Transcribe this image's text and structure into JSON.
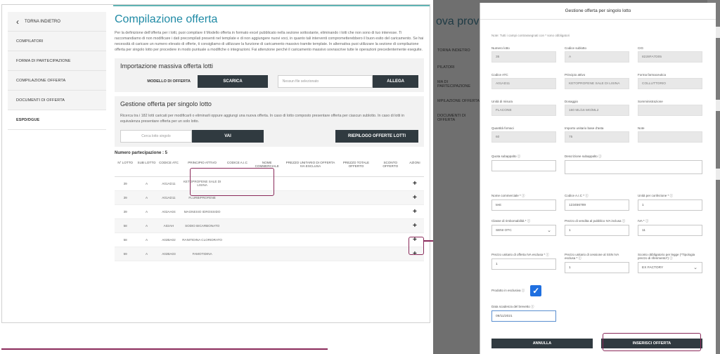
{
  "sidebar": {
    "back_label": "TORNA INDIETRO",
    "items": [
      {
        "label": "COMPILATORI"
      },
      {
        "label": "FORMA DI PARTECIPAZIONE"
      },
      {
        "label": "COMPILAZIONE OFFERTA"
      },
      {
        "label": "DOCUMENTI DI OFFERTA"
      },
      {
        "label": "ESPD/DGUE"
      }
    ]
  },
  "main": {
    "title": "Compilazione offerta",
    "intro": "Per la definizione dell'offerta per i lotti, puoi compilare il Modello offerta in formato excel pubblicato nella sezione sottostante, eliminando i lotti che non sono di tuo interesse. Ti raccomandiamo di non modificare i dati precompilati presenti nel template e di non aggiungere nuovi voci, in quanto tali interventi comprometterebbero il buon esito del caricamento. Se hai necessità di caricare un numero elevato di offerte, ti consigliamo di utilizzare la funzione di caricamento massivo tramite template. In alternativa puoi utilizzare la sezione di compilazione offerta per singolo lotto per procedere in modo puntuale a modifiche o integrazioni. Fai attenzione perché il caricamento massivo sovrascrive tutte le operazioni precedentemente eseguite.",
    "bulk": {
      "title": "Importazione massiva offerta lotti",
      "model_label": "MODELLO DI OFFERTA",
      "download_label": "SCARICA",
      "file_placeholder": "Nessun file selezionato",
      "attach_label": "ALLEGA"
    },
    "single": {
      "title": "Gestione offerta per singolo lotto",
      "description": "Ricerca tra i 182 lotti caricati per modificarli o eliminarli oppure aggiungi una nuova offerta. In caso di lotto composto presentare offerta per ciascun sublotto. In caso di lotti in equivalenza presentare offerta per un solo lotto.",
      "search_placeholder": "Cerca lotto singolo",
      "go_label": "VAI",
      "summary_label": "RIEPILOGO OFFERTE LOTTI"
    },
    "participations": "Numero partecipazione : 5",
    "table": {
      "headers": [
        "N° LOTTO",
        "SUB LOTTO",
        "CODICE ATC",
        "PRINCIPIO ATTIVO",
        "CODICE A.I.C",
        "NOME COMMERCIALE",
        "PREZZO UNITARIO DI OFFERTA IVA ESCLUSA",
        "PREZZO TOTALE OFFERTO",
        "SCONTO OFFERTO",
        "AZIONI"
      ],
      "rows": [
        {
          "lotto": "39",
          "sub": "A",
          "atc": "A01AD11",
          "principio": "KETOPROFENE SALE DI LISINA"
        },
        {
          "lotto": "39",
          "sub": "A",
          "atc": "A01AD11",
          "principio": "FLURBIPROFENE"
        },
        {
          "lotto": "39",
          "sub": "A",
          "atc": "A02AA04",
          "principio": "MAGNESIO IDROSSIDO"
        },
        {
          "lotto": "58",
          "sub": "A",
          "atc": "A02AH",
          "principio": "SODIO BICARBONATO"
        },
        {
          "lotto": "58",
          "sub": "A",
          "atc": "A02BA02",
          "principio": "RANITIDINA CLORIDRATO"
        },
        {
          "lotto": "59",
          "sub": "A",
          "atc": "A02BA03",
          "principio": "FAMOTIDINA"
        }
      ]
    }
  },
  "background": {
    "title": "ova prova",
    "side_items": [
      "TORNA INDIETRO",
      "PILATORI",
      "MA DI PARTECIPAZIONE",
      "MPILAZIONE OFFERTA",
      "DOCUMENTI DI OFFERTA"
    ]
  },
  "modal": {
    "title": "Gestione offerta per singolo lotto",
    "note": "Note: Tutti i campi contrassegnati con * sono obbligatori",
    "fields": {
      "numero_lotto": {
        "label": "Numero lotto",
        "value": "35"
      },
      "codice_sublotto": {
        "label": "Codice sublotto",
        "value": "A"
      },
      "cig": {
        "label": "CIG",
        "value": "8228FA7D05"
      },
      "codice_atc": {
        "label": "Codice ATC",
        "value": "A01AD11"
      },
      "principio_attivo": {
        "label": "Principio attivo",
        "value": "KETOPROFENE SALE DI LISINA"
      },
      "forma_farmaceutica": {
        "label": "Forma farmaceutica",
        "value": "COLLUTTORIO"
      },
      "unita_misura": {
        "label": "Unità di misura",
        "value": "FLACONE"
      },
      "dosaggio": {
        "label": "Dosaggio",
        "value": "160 ML/16 MG/ML2"
      },
      "somministrazione": {
        "label": "Somministrazione",
        "value": ""
      },
      "quantita": {
        "label": "Quantità fornaci",
        "value": "60"
      },
      "importo_base": {
        "label": "Importo unitario base d'asta",
        "value": "75"
      },
      "note": {
        "label": "Note",
        "value": ""
      },
      "quota_subappalto": {
        "label": "Quota subappalto ⓘ",
        "value": ""
      },
      "descrizione_subappalto": {
        "label": "Descrizione subappalto ⓘ",
        "value": ""
      },
      "nome_commerciale": {
        "label": "Nome commerciale * ⓘ",
        "value": "test"
      },
      "codice_aic": {
        "label": "Codice A.I.C * ⓘ",
        "value": "123456789"
      },
      "unita_confezione": {
        "label": "Unità per confezione * ⓘ",
        "value": "1"
      },
      "classe_rimborsabilita": {
        "label": "Classe di rimborsabilità * ⓘ",
        "value": "SENI OTC"
      },
      "prezzo_vendita": {
        "label": "Prezzo di vendita al pubblico IVA inclusa ⓘ",
        "value": "1"
      },
      "iva": {
        "label": "IVA * ⓘ",
        "value": "11"
      },
      "prezzo_offerta": {
        "label": "Prezzo unitario di offerta IVA esclusa * ⓘ",
        "value": "1"
      },
      "prezzo_cessione": {
        "label": "Prezzo unitario di cessione al SSN IVA esclusa * ⓘ",
        "value": "1"
      },
      "sconto_obbligatorio": {
        "label": "Sconto obbligatorio per legge (*Tipologia prezzo di riferimento*) ⓘ",
        "value": "EX FACTORY"
      },
      "prodotto_esclusiva": {
        "label": "Prodotto in esclusiva ⓘ"
      },
      "data_scadenza": {
        "label": "Data scadenza del brevetto ⓘ",
        "value": "09/11/2021"
      }
    },
    "cancel_label": "ANNULLA",
    "submit_label": "INSERISCI OFFERTA"
  },
  "colors": {
    "accent": "#1f8aa5",
    "dark_button": "#303a40",
    "highlight": "#8a2a5a",
    "checkbox": "#1f6fe0"
  }
}
